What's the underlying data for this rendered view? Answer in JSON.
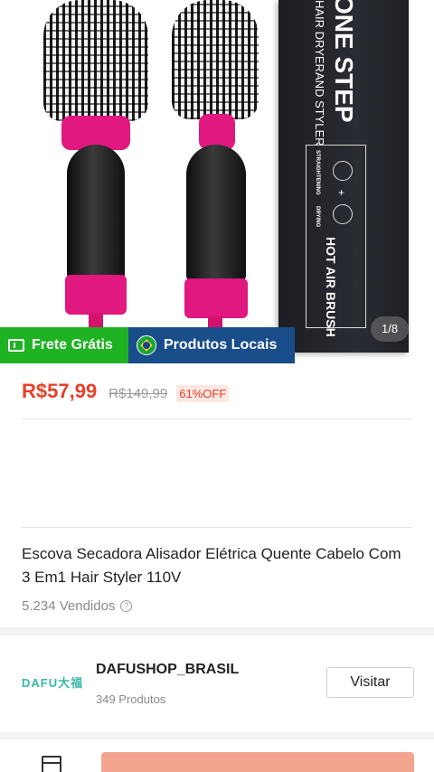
{
  "product_image": {
    "counter": "1/8",
    "box_text": {
      "brand": "ONE STEP",
      "subtitle": "HAIR DRYERAND STYLER",
      "features": [
        "STRAIGHTENING",
        "DRYING"
      ],
      "name": "HOT AIR BRUSH"
    },
    "colors": {
      "accent": "#e0187f",
      "handle": "#1a1a1a",
      "box": "#1f2127"
    }
  },
  "badges": {
    "free_shipping": "Frete Grátis",
    "local_products": "Produtos Locais",
    "free_shipping_icon": "truck-icon",
    "local_products_icon": "brazil-flag-icon",
    "colors": {
      "free_shipping_bg": "#1fb323",
      "local_products_bg": "#184d8a"
    }
  },
  "pricing": {
    "price": "R$57,99",
    "original_price": "R$149,99",
    "discount": "61%OFF",
    "color": "#e5402b"
  },
  "product": {
    "title": "Escova Secadora Alisador Elétrica Quente Cabelo Com 3 Em1 Hair Styler 110V",
    "sold": "5.234 Vendidos",
    "info_icon": "info-icon"
  },
  "shop": {
    "logo_text": "DAFU大福",
    "name": "DAFUSHOP_BRASIL",
    "products_count": "349 Produtos",
    "visit_label": "Visitar"
  },
  "bottom_bar": {
    "store_icon": "store-icon",
    "buy_color": "#f4a58f"
  }
}
